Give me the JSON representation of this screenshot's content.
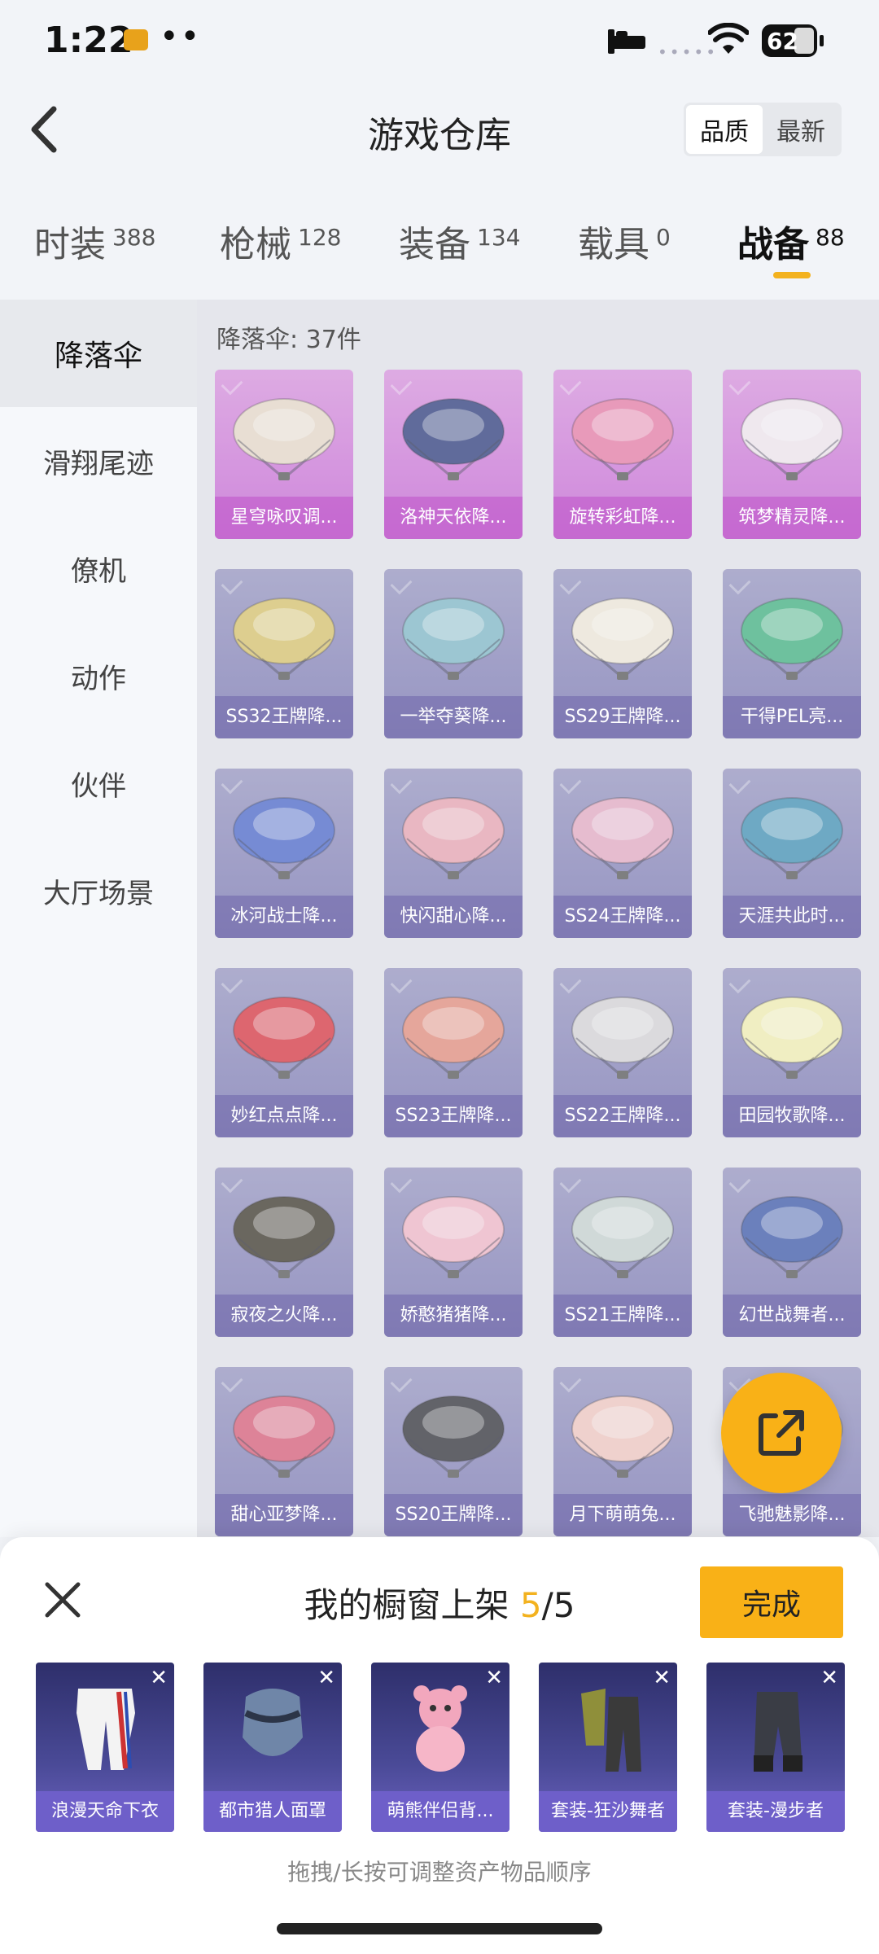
{
  "status_bar": {
    "time": "1:22",
    "dots": "••",
    "signal": "•••••",
    "battery": "62"
  },
  "header": {
    "title": "游戏仓库",
    "sort_options": [
      {
        "label": "品质",
        "active": true
      },
      {
        "label": "最新",
        "active": false
      }
    ]
  },
  "tabs": [
    {
      "label": "时装",
      "count": "388"
    },
    {
      "label": "枪械",
      "count": "128"
    },
    {
      "label": "装备",
      "count": "134"
    },
    {
      "label": "载具",
      "count": "0"
    },
    {
      "label": "战备",
      "count": "88",
      "active": true
    }
  ],
  "sidebar": {
    "items": [
      {
        "label": "降落伞",
        "active": true
      },
      {
        "label": "滑翔尾迹"
      },
      {
        "label": "僚机"
      },
      {
        "label": "动作"
      },
      {
        "label": "伙伴"
      },
      {
        "label": "大厅场景"
      }
    ]
  },
  "content": {
    "count_label": "降落伞: 37件"
  },
  "items": [
    {
      "name": "星穹咏叹调...",
      "rarity": "pink",
      "color": "#e8d9c8"
    },
    {
      "name": "洛神天依降...",
      "rarity": "pink",
      "color": "#2b3a7a"
    },
    {
      "name": "旋转彩虹降...",
      "rarity": "pink",
      "color": "#e87aa6"
    },
    {
      "name": "筑梦精灵降...",
      "rarity": "pink",
      "color": "#f1e6ee"
    },
    {
      "name": "SS32王牌降...",
      "rarity": "purple",
      "color": "#d9c36a"
    },
    {
      "name": "一举夺葵降...",
      "rarity": "purple",
      "color": "#7fb7c6"
    },
    {
      "name": "SS29王牌降...",
      "rarity": "purple",
      "color": "#f0e8d8"
    },
    {
      "name": "干得PEL亮...",
      "rarity": "purple",
      "color": "#3fb07f"
    },
    {
      "name": "冰河战士降...",
      "rarity": "purple",
      "color": "#4a66c9"
    },
    {
      "name": "快闪甜心降...",
      "rarity": "purple",
      "color": "#e9a3b0"
    },
    {
      "name": "SS24王牌降...",
      "rarity": "purple",
      "color": "#e5a9c3"
    },
    {
      "name": "天涯共此时...",
      "rarity": "purple",
      "color": "#3f8fb3"
    },
    {
      "name": "妙红点点降...",
      "rarity": "purple",
      "color": "#d8323e"
    },
    {
      "name": "SS23王牌降...",
      "rarity": "purple",
      "color": "#e48b7a"
    },
    {
      "name": "SS22王牌降...",
      "rarity": "purple",
      "color": "#d6d3d6"
    },
    {
      "name": "田园牧歌降...",
      "rarity": "purple",
      "color": "#f3efb0"
    },
    {
      "name": "寂夜之火降...",
      "rarity": "purple",
      "color": "#3a3428"
    },
    {
      "name": "娇憨猪猪降...",
      "rarity": "purple",
      "color": "#f1b6c6"
    },
    {
      "name": "SS21王牌降...",
      "rarity": "purple",
      "color": "#c7d2cf"
    },
    {
      "name": "幻世战舞者...",
      "rarity": "purple",
      "color": "#3b56a8"
    },
    {
      "name": "甜心亚梦降...",
      "rarity": "purple",
      "color": "#d85a76"
    },
    {
      "name": "SS20王牌降...",
      "rarity": "purple",
      "color": "#2f2f35"
    },
    {
      "name": "月下萌萌兔...",
      "rarity": "purple",
      "color": "#f2c7c0"
    },
    {
      "name": "飞驰魅影降...",
      "rarity": "purple",
      "color": "#c9b25b"
    }
  ],
  "showcase": {
    "title_prefix": "我的橱窗上架 ",
    "count_current": "5",
    "count_total": "/5",
    "done_label": "完成",
    "hint": "拖拽/长按可调整资产物品顺序",
    "items": [
      {
        "name": "浪漫天命下衣",
        "icon": "pants-icon"
      },
      {
        "name": "都市猎人面罩",
        "icon": "mask-icon"
      },
      {
        "name": "萌熊伴侣背...",
        "icon": "bear-backpack-icon"
      },
      {
        "name": "套装-狂沙舞者",
        "icon": "outfit-icon"
      },
      {
        "name": "套装-漫步者",
        "icon": "outfit-icon"
      }
    ]
  },
  "colors": {
    "accent": "#f9b117",
    "tab_indicator": "#f3b21f"
  }
}
